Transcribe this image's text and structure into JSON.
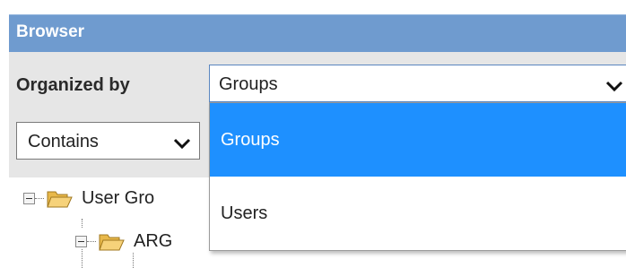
{
  "panel": {
    "title": "Browser"
  },
  "toolbar": {
    "organized_by_label": "Organized by",
    "organized_by_value": "Groups",
    "filter_value": "Contains"
  },
  "dropdown": {
    "options": [
      {
        "label": "Groups",
        "selected": true
      },
      {
        "label": "Users",
        "selected": false
      }
    ]
  },
  "tree": {
    "root_label": "User Gro",
    "child_label": "ARG"
  },
  "colors": {
    "header_bg": "#6f9bcf",
    "selected_option_bg": "#1e90ff",
    "toolbar_bg": "#e6e6e6"
  }
}
